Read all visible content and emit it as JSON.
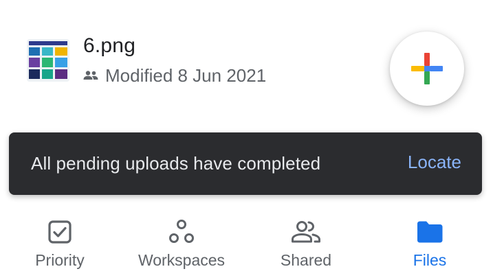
{
  "file": {
    "name": "6.png",
    "modified": "Modified 8 Jun 2021",
    "shared_icon": "people-icon",
    "thumbnail_icon": "image-thumbnail"
  },
  "fab": {
    "icon": "plus-icon",
    "colors": [
      "#4285F4",
      "#EA4335",
      "#FBBC04",
      "#34A853"
    ]
  },
  "snackbar": {
    "message": "All pending uploads have completed",
    "action": "Locate",
    "action_color": "#8ab4f8"
  },
  "bottom_nav": {
    "items": [
      {
        "label": "Priority",
        "icon": "checkbox-icon",
        "active": false
      },
      {
        "label": "Workspaces",
        "icon": "workspaces-icon",
        "active": false
      },
      {
        "label": "Shared",
        "icon": "people-icon",
        "active": false
      },
      {
        "label": "Files",
        "icon": "folder-icon",
        "active": true
      }
    ],
    "active_color": "#1a73e8"
  }
}
